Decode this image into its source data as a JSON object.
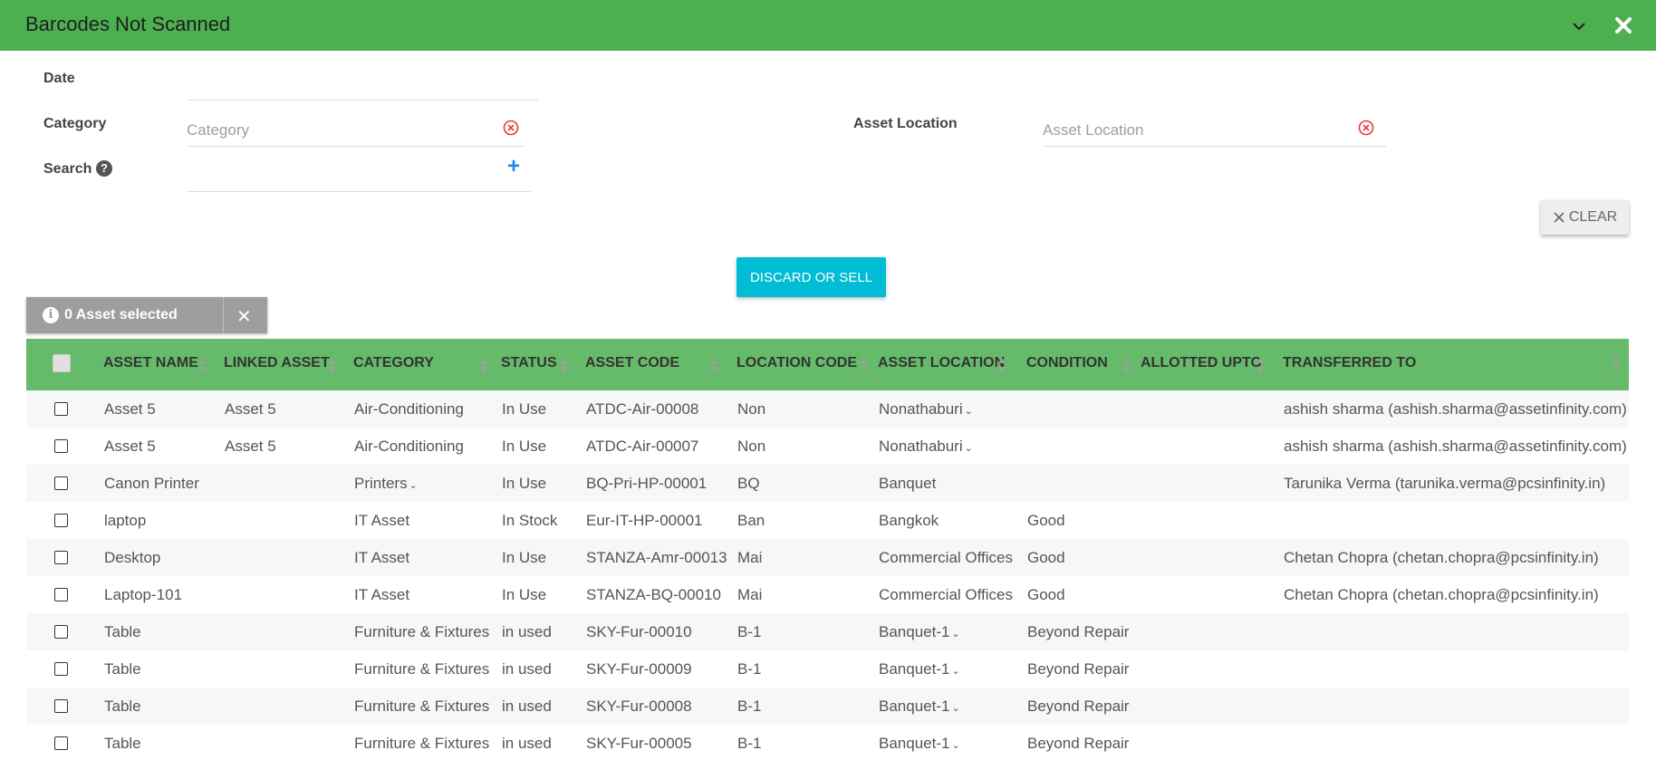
{
  "header": {
    "title": "Barcodes Not Scanned"
  },
  "filters": {
    "date_label": "Date",
    "category_label": "Category",
    "category_placeholder": "Category",
    "asset_location_label": "Asset Location",
    "asset_location_placeholder": "Asset Location",
    "search_label": "Search"
  },
  "actions": {
    "clear_label": "CLEAR",
    "discard_label": "DISCARD OR SELL",
    "selected_text": "0 Asset selected"
  },
  "table": {
    "columns": [
      "ASSET NAME",
      "LINKED ASSET",
      "CATEGORY",
      "STATUS",
      "ASSET CODE",
      "LOCATION CODE",
      "ASSET LOCATION",
      "CONDITION",
      "ALLOTTED UPTO",
      "TRANSFERRED TO"
    ],
    "rows": [
      {
        "asset_name": "Asset 5",
        "linked_asset": "Asset 5",
        "category": "Air-Conditioning",
        "status": "In Use",
        "asset_code": "ATDC-Air-00008",
        "location_code": "Non",
        "asset_location": "Nonathaburi",
        "condition": "",
        "allotted_upto": "",
        "transferred_to": "ashish sharma (ashish.sharma@assetinfinity.com)"
      },
      {
        "asset_name": "Asset 5",
        "linked_asset": "Asset 5",
        "category": "Air-Conditioning",
        "status": "In Use",
        "asset_code": "ATDC-Air-00007",
        "location_code": "Non",
        "asset_location": "Nonathaburi",
        "condition": "",
        "allotted_upto": "",
        "transferred_to": "ashish sharma (ashish.sharma@assetinfinity.com)"
      },
      {
        "asset_name": "Canon Printer",
        "linked_asset": "",
        "category": "Printers",
        "status": "In Use",
        "asset_code": "BQ-Pri-HP-00001",
        "location_code": "BQ",
        "asset_location": "Banquet",
        "condition": "",
        "allotted_upto": "",
        "transferred_to": "Tarunika Verma (tarunika.verma@pcsinfinity.in)"
      },
      {
        "asset_name": "laptop",
        "linked_asset": "",
        "category": "IT Asset",
        "status": "In Stock",
        "asset_code": "Eur-IT-HP-00001",
        "location_code": "Ban",
        "asset_location": "Bangkok",
        "condition": "Good",
        "allotted_upto": "",
        "transferred_to": ""
      },
      {
        "asset_name": "Desktop",
        "linked_asset": "",
        "category": "IT Asset",
        "status": "In Use",
        "asset_code": "STANZA-Amr-00013",
        "location_code": "Mai",
        "asset_location": "Commercial Offices",
        "condition": "Good",
        "allotted_upto": "",
        "transferred_to": "Chetan Chopra (chetan.chopra@pcsinfinity.in)"
      },
      {
        "asset_name": "Laptop-101",
        "linked_asset": "",
        "category": "IT Asset",
        "status": "In Use",
        "asset_code": "STANZA-BQ-00010",
        "location_code": "Mai",
        "asset_location": "Commercial Offices",
        "condition": "Good",
        "allotted_upto": "",
        "transferred_to": "Chetan Chopra (chetan.chopra@pcsinfinity.in)"
      },
      {
        "asset_name": "Table",
        "linked_asset": "",
        "category": "Furniture & Fixtures",
        "status": "in used",
        "asset_code": "SKY-Fur-00010",
        "location_code": "B-1",
        "asset_location": "Banquet-1",
        "condition": "Beyond Repair",
        "allotted_upto": "",
        "transferred_to": ""
      },
      {
        "asset_name": "Table",
        "linked_asset": "",
        "category": "Furniture & Fixtures",
        "status": "in used",
        "asset_code": "SKY-Fur-00009",
        "location_code": "B-1",
        "asset_location": "Banquet-1",
        "condition": "Beyond Repair",
        "allotted_upto": "",
        "transferred_to": ""
      },
      {
        "asset_name": "Table",
        "linked_asset": "",
        "category": "Furniture & Fixtures",
        "status": "in used",
        "asset_code": "SKY-Fur-00008",
        "location_code": "B-1",
        "asset_location": "Banquet-1",
        "condition": "Beyond Repair",
        "allotted_upto": "",
        "transferred_to": ""
      },
      {
        "asset_name": "Table",
        "linked_asset": "",
        "category": "Furniture & Fixtures",
        "status": "in used",
        "asset_code": "SKY-Fur-00005",
        "location_code": "B-1",
        "asset_location": "Banquet-1",
        "condition": "Beyond Repair",
        "allotted_upto": "",
        "transferred_to": ""
      }
    ]
  },
  "dropdown_cells": {
    "rows_with_location_dropdown": [
      0,
      1,
      6,
      7,
      8,
      9
    ],
    "rows_with_category_dropdown": [
      2
    ]
  },
  "colors": {
    "header_green": "#4caf50",
    "table_header_green": "#66bb6a",
    "discard_button": "#00bcd4",
    "clear_icon_red": "#e53935",
    "plus_blue": "#1e88e5"
  },
  "icons": {
    "collapse": "chevron-down-icon",
    "close": "close-icon",
    "clear_field": "circle-x-icon",
    "add": "plus-icon",
    "help": "question-circle-icon",
    "info": "info-circle-icon",
    "sort": "sort-arrows-icon"
  }
}
